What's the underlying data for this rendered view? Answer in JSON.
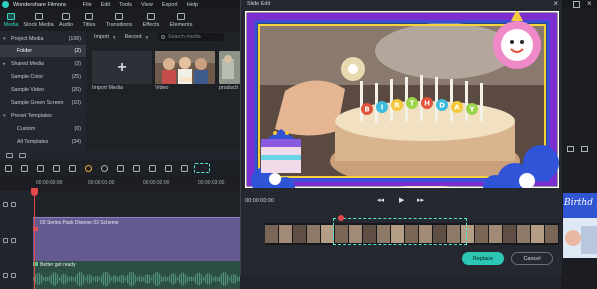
{
  "titlebar": {
    "app_name": "Wondershare Filmora",
    "menus": [
      "File",
      "Edit",
      "Tools",
      "View",
      "Export",
      "Help"
    ]
  },
  "toolbar": {
    "tabs": [
      "Media",
      "Stock Media",
      "Audio",
      "Titles",
      "Transitions",
      "Effects",
      "Elements"
    ],
    "active": "Media"
  },
  "left_panel": {
    "items": [
      {
        "label": "Project Media",
        "count": "(106)",
        "caret": "▾"
      },
      {
        "label": "Folder",
        "count": "(2)"
      },
      {
        "label": "Shared Media",
        "count": "(3)",
        "caret": "▸"
      },
      {
        "label": "Sample Color",
        "count": "(25)"
      },
      {
        "label": "Sample Video",
        "count": "(20)"
      },
      {
        "label": "Sample Green Screen",
        "count": "(10)"
      },
      {
        "label": "Preset Templates",
        "count": "",
        "caret": "▾"
      },
      {
        "label": "Custom",
        "count": "(0)"
      },
      {
        "label": "All Templates",
        "count": "(34)"
      }
    ]
  },
  "media": {
    "import_label": "Import",
    "record_label": "Record",
    "search_placeholder": "Search media",
    "items": [
      {
        "label": "Import Media"
      },
      {
        "label": "Video"
      },
      {
        "label": "producti"
      }
    ]
  },
  "timeline": {
    "ruler": [
      "00:00:00:00",
      "00:00:01:00",
      "00:00:02:00",
      "00:00:03:00"
    ],
    "video_clip_name": "03 Series Pack Diverse 03 Scheme",
    "audio_clip_name": "Better get ready"
  },
  "dialog": {
    "title": "Slide Edit",
    "close": "×",
    "time": "00:00:00:00",
    "replace_label": "Replace",
    "cancel_label": "Cancel",
    "balloon_letters": [
      "B",
      "I",
      "R",
      "T",
      "H",
      "D",
      "A",
      "Y"
    ]
  },
  "right_preview": {
    "thumb_text": "Birthd"
  },
  "colors": {
    "accent": "#2bc6b4",
    "playhead": "#e6484a",
    "frame_purple": "#7b2fd0",
    "frame_blue": "#2f54d8",
    "frame_yellow": "#f5d33b"
  }
}
